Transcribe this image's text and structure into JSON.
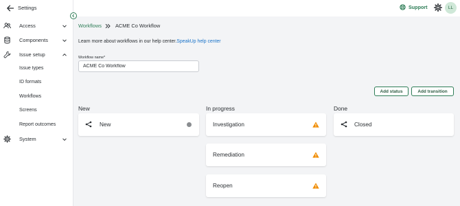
{
  "sidebar": {
    "title": "Settings",
    "nav": [
      {
        "label": "Access",
        "icon": "users-icon",
        "expanded": false
      },
      {
        "label": "Components",
        "icon": "database-icon",
        "expanded": false
      },
      {
        "label": "Issue setup",
        "icon": "wrench-icon",
        "expanded": true
      },
      {
        "label": "System",
        "icon": "gear-icon",
        "expanded": false
      }
    ],
    "issue_setup_items": [
      "Issue types",
      "ID formats",
      "Workflows",
      "Screens",
      "Report outcomes"
    ]
  },
  "topbar": {
    "support_label": "Support",
    "avatar_initials": "LL"
  },
  "breadcrumb": {
    "parent": "Workflows",
    "current": "ACME Co Workflow"
  },
  "help": {
    "text": "Learn more about workflows in our help center.",
    "link_text": "SpeakUp help center"
  },
  "workflow_name": {
    "label": "Workflow name*",
    "value": "ACME Co Workflow"
  },
  "actions": {
    "add_status": "Add status",
    "add_transition": "Add transition"
  },
  "columns": [
    {
      "title": "New",
      "cards": [
        {
          "label": "New",
          "icon": "transition-icon",
          "indicator": "grey-dot"
        }
      ]
    },
    {
      "title": "In progress",
      "cards": [
        {
          "label": "Investigation",
          "indicator": "warning-icon"
        },
        {
          "label": "Remediation",
          "indicator": "warning-icon"
        },
        {
          "label": "Reopen",
          "indicator": "warning-icon"
        }
      ]
    },
    {
      "title": "Done",
      "cards": [
        {
          "label": "Closed",
          "icon": "transition-icon",
          "indicator": "none"
        }
      ]
    }
  ],
  "colors": {
    "brand_green": "#2e7d57",
    "link_blue": "#1a73c9",
    "warning_orange": "#f08c00"
  }
}
